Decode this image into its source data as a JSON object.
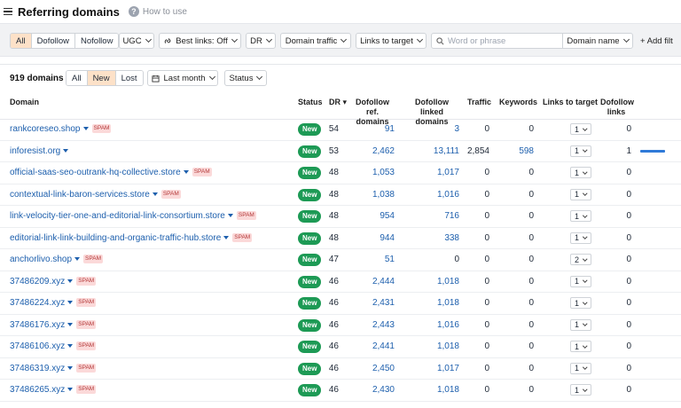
{
  "header": {
    "title": "Referring domains",
    "help_icon": "?",
    "how_to": "How to use"
  },
  "filters": {
    "seg": [
      "All",
      "Dofollow",
      "Nofollow"
    ],
    "ugc": "UGC",
    "best_links": "Best links: Off",
    "dr": "DR",
    "domain_traffic": "Domain traffic",
    "links_to_target": "Links to target",
    "search_placeholder": "Word or phrase",
    "scope": "Domain name",
    "add_filter": "+ Add filt"
  },
  "summary": {
    "count": "919 domains",
    "seg": [
      "All",
      "New",
      "Lost"
    ],
    "period": "Last month",
    "status": "Status"
  },
  "columns": {
    "domain": "Domain",
    "status": "Status",
    "dr": "DR ▾",
    "dofollow_ref_1": "Dofollow ref.",
    "dofollow_ref_2": "domains",
    "dofollow_linked_1": "Dofollow linked",
    "dofollow_linked_2": "domains",
    "traffic": "Traffic",
    "keywords": "Keywords",
    "links_to_target": "Links to target",
    "dofollow_links_1": "Dofollow",
    "dofollow_links_2": "links"
  },
  "rows": [
    {
      "domain": "rankcoreseo.shop",
      "spam": "SPAM",
      "status": "New",
      "dr": "54",
      "ref": "91",
      "linked": "3",
      "traffic": "0",
      "keywords": "0",
      "lt": "1",
      "dl": "0"
    },
    {
      "domain": "inforesist.org",
      "spam": "",
      "status": "New",
      "dr": "53",
      "ref": "2,462",
      "linked": "13,111",
      "traffic": "2,854",
      "keywords": "598",
      "lt": "1",
      "dl": "1"
    },
    {
      "domain": "official-saas-seo-outrank-hq-collective.store",
      "spam": "SPAM",
      "status": "New",
      "dr": "48",
      "ref": "1,053",
      "linked": "1,017",
      "traffic": "0",
      "keywords": "0",
      "lt": "1",
      "dl": "0"
    },
    {
      "domain": "contextual-link-baron-services.store",
      "spam": "SPAM",
      "status": "New",
      "dr": "48",
      "ref": "1,038",
      "linked": "1,016",
      "traffic": "0",
      "keywords": "0",
      "lt": "1",
      "dl": "0"
    },
    {
      "domain": "link-velocity-tier-one-and-editorial-link-consortium.store",
      "spam": "SPAM",
      "status": "New",
      "dr": "48",
      "ref": "954",
      "linked": "716",
      "traffic": "0",
      "keywords": "0",
      "lt": "1",
      "dl": "0"
    },
    {
      "domain": "editorial-link-link-building-and-organic-traffic-hub.store",
      "spam": "SPAM",
      "status": "New",
      "dr": "48",
      "ref": "944",
      "linked": "338",
      "traffic": "0",
      "keywords": "0",
      "lt": "1",
      "dl": "0"
    },
    {
      "domain": "anchorlivo.shop",
      "spam": "SPAM",
      "status": "New",
      "dr": "47",
      "ref": "51",
      "linked": "0",
      "traffic": "0",
      "keywords": "0",
      "lt": "2",
      "dl": "0"
    },
    {
      "domain": "37486209.xyz",
      "spam": "SPAM",
      "status": "New",
      "dr": "46",
      "ref": "2,444",
      "linked": "1,018",
      "traffic": "0",
      "keywords": "0",
      "lt": "1",
      "dl": "0"
    },
    {
      "domain": "37486224.xyz",
      "spam": "SPAM",
      "status": "New",
      "dr": "46",
      "ref": "2,431",
      "linked": "1,018",
      "traffic": "0",
      "keywords": "0",
      "lt": "1",
      "dl": "0"
    },
    {
      "domain": "37486176.xyz",
      "spam": "SPAM",
      "status": "New",
      "dr": "46",
      "ref": "2,443",
      "linked": "1,016",
      "traffic": "0",
      "keywords": "0",
      "lt": "1",
      "dl": "0"
    },
    {
      "domain": "37486106.xyz",
      "spam": "SPAM",
      "status": "New",
      "dr": "46",
      "ref": "2,441",
      "linked": "1,018",
      "traffic": "0",
      "keywords": "0",
      "lt": "1",
      "dl": "0"
    },
    {
      "domain": "37486319.xyz",
      "spam": "SPAM",
      "status": "New",
      "dr": "46",
      "ref": "2,450",
      "linked": "1,017",
      "traffic": "0",
      "keywords": "0",
      "lt": "1",
      "dl": "0"
    },
    {
      "domain": "37486265.xyz",
      "spam": "SPAM",
      "status": "New",
      "dr": "46",
      "ref": "2,430",
      "linked": "1,018",
      "traffic": "0",
      "keywords": "0",
      "lt": "1",
      "dl": "0"
    }
  ]
}
